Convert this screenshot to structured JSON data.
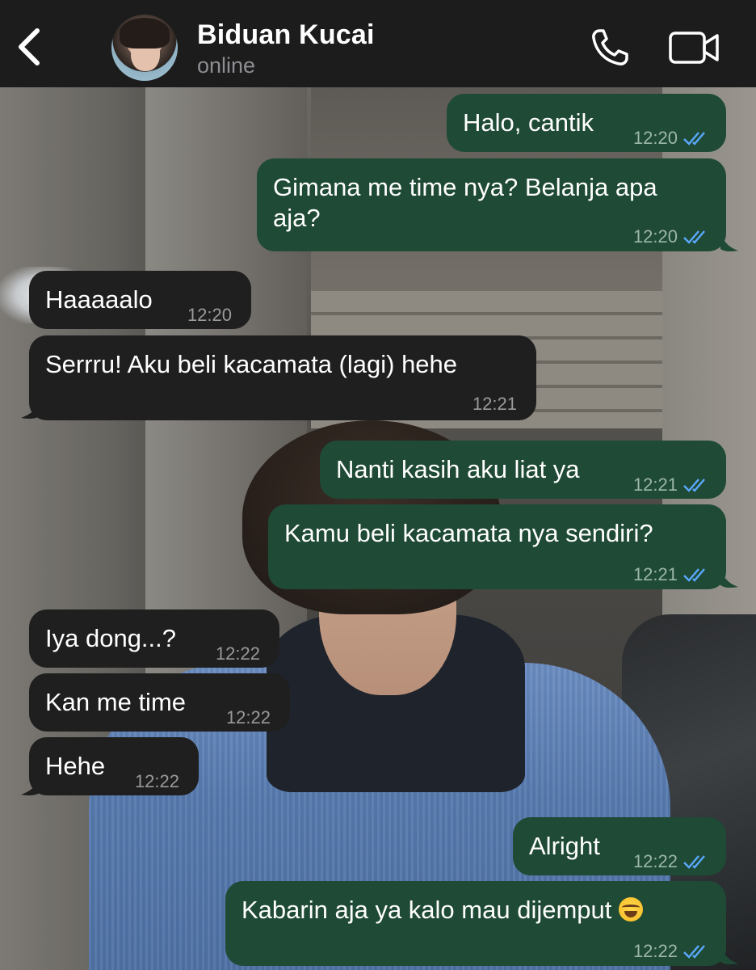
{
  "header": {
    "contact_name": "Biduan Kucai",
    "status": "online",
    "back_icon": "chevron-left-icon",
    "call_icon": "phone-icon",
    "video_icon": "video-camera-icon"
  },
  "colors": {
    "header_bg": "#1c1c1c",
    "outgoing_bubble": "#1f4a35",
    "incoming_bubble": "#1f1f1f",
    "read_ticks": "#5aa9ff"
  },
  "messages": [
    {
      "direction": "out",
      "text": "Halo, cantik",
      "time": "12:20",
      "read": true
    },
    {
      "direction": "out",
      "text": "Gimana me time nya? Belanja apa aja?",
      "time": "12:20",
      "read": true
    },
    {
      "direction": "in",
      "text": "Haaaaalo",
      "time": "12:20"
    },
    {
      "direction": "in",
      "text": "Serrru! Aku beli kacamata (lagi) hehe",
      "time": "12:21"
    },
    {
      "direction": "out",
      "text": "Nanti kasih aku liat ya",
      "time": "12:21",
      "read": true
    },
    {
      "direction": "out",
      "text": "Kamu beli kacamata nya sendiri?",
      "time": "12:21",
      "read": true
    },
    {
      "direction": "in",
      "text": "Iya dong...?",
      "time": "12:22"
    },
    {
      "direction": "in",
      "text": "Kan me time",
      "time": "12:22"
    },
    {
      "direction": "in",
      "text": "Hehe",
      "time": "12:22"
    },
    {
      "direction": "out",
      "text": "Alright",
      "time": "12:22",
      "read": true
    },
    {
      "direction": "out",
      "text": "Kabarin aja ya kalo mau dijemput",
      "emoji": "face-with-tears-of-joy",
      "time": "12:22",
      "read": true
    }
  ]
}
